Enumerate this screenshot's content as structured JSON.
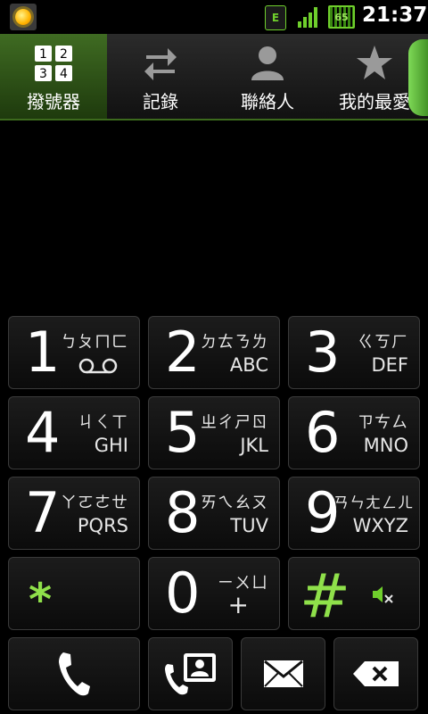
{
  "status_bar": {
    "time": "21:37",
    "network_badge": "E",
    "battery_level": "65",
    "icons": [
      "brightness-icon",
      "edge-data-icon",
      "signal-icon",
      "battery-icon"
    ]
  },
  "tabs": [
    {
      "label": "撥號器",
      "icon": "dialpad-icon",
      "active": true,
      "grid": [
        "1",
        "2",
        "3",
        "4"
      ]
    },
    {
      "label": "記錄",
      "icon": "call-log-icon",
      "active": false
    },
    {
      "label": "聯絡人",
      "icon": "contacts-icon",
      "active": false
    },
    {
      "label": "我的最愛",
      "icon": "star-icon",
      "active": false
    }
  ],
  "keypad": {
    "keys": [
      {
        "digit": "1",
        "bopomofo": "ㄅㄆㄇㄈ",
        "letters": "",
        "extra": "voicemail-icon"
      },
      {
        "digit": "2",
        "bopomofo": "ㄉㄊㄋㄌ",
        "letters": "ABC"
      },
      {
        "digit": "3",
        "bopomofo": "ㄍㄎㄏ",
        "letters": "DEF"
      },
      {
        "digit": "4",
        "bopomofo": "ㄐㄑㄒ",
        "letters": "GHI"
      },
      {
        "digit": "5",
        "bopomofo": "ㄓㄔㄕㄖ",
        "letters": "JKL"
      },
      {
        "digit": "6",
        "bopomofo": "ㄗㄘㄙ",
        "letters": "MNO"
      },
      {
        "digit": "7",
        "bopomofo": "ㄚㄛㄜㄝ",
        "letters": "PQRS"
      },
      {
        "digit": "8",
        "bopomofo": "ㄞㄟㄠㄡ",
        "letters": "TUV"
      },
      {
        "digit": "9",
        "bopomofo": "ㄢㄣㄤㄥㄦ",
        "letters": "WXYZ"
      },
      {
        "digit": "*",
        "bopomofo": "",
        "letters": ""
      },
      {
        "digit": "0",
        "bopomofo": "ㄧㄨㄩ",
        "letters": "+"
      },
      {
        "digit": "#",
        "bopomofo": "",
        "letters": "",
        "extra": "mute-icon"
      }
    ]
  },
  "actions": [
    {
      "name": "call-button",
      "icon": "phone-icon"
    },
    {
      "name": "add-to-contacts-button",
      "icon": "phone-contact-icon"
    },
    {
      "name": "send-message-button",
      "icon": "envelope-icon"
    },
    {
      "name": "delete-button",
      "icon": "backspace-icon"
    }
  ],
  "colors": {
    "accent": "#8fe04a",
    "tab_active": "#3f6b22",
    "background": "#000000"
  }
}
